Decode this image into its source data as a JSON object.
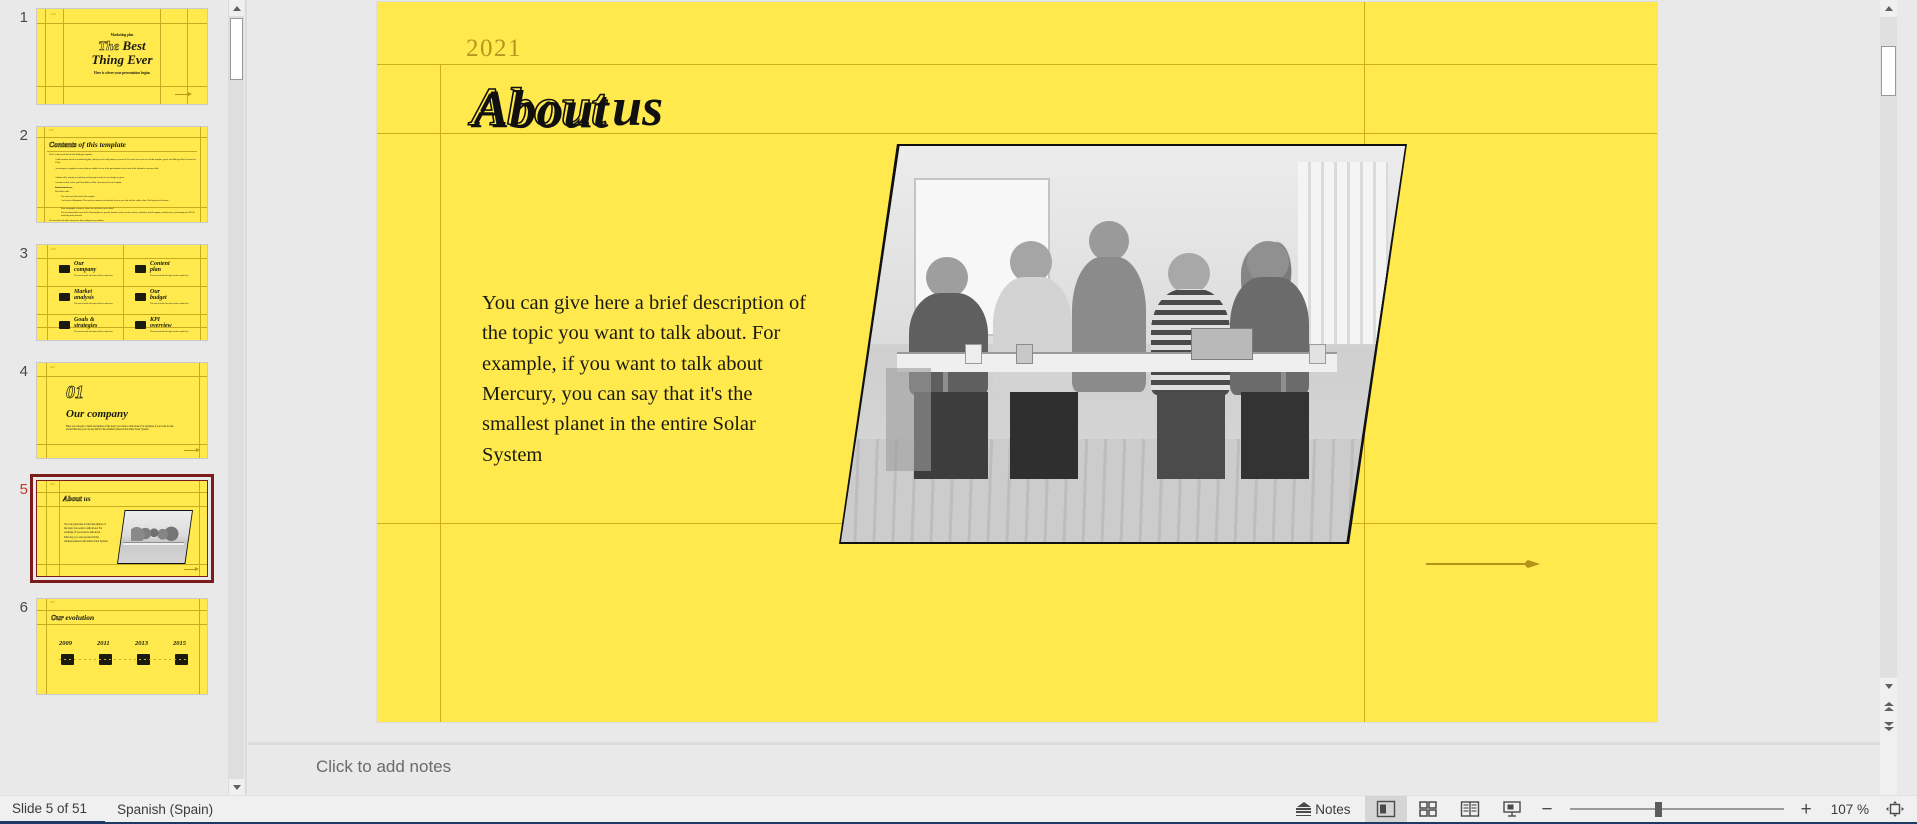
{
  "app": {
    "accent_color": "#1f3864",
    "slide_bg": "#ffe94d",
    "slide_rule_color": "#cfae1d",
    "ink_color": "#101010",
    "muted_gold": "#b3971f",
    "selection_border": "#7b1b1b"
  },
  "thumbnails": {
    "panel_name": "slide-thumbnail-panel",
    "slides": [
      {
        "number": "1",
        "selected": false,
        "kind": "title",
        "eyebrow": "Marketing plan",
        "title_hollow": "The",
        "title_solid": "Best",
        "title_line2": "Thing Ever",
        "subtitle": "Here is where your presentation begins"
      },
      {
        "number": "2",
        "selected": false,
        "kind": "contents",
        "title_hollow": "Contents",
        "title_solid": "of this template",
        "intro": "Here's what you'll find in this Slidesgo template:",
        "items": [
          "A slide structure based on a marketing plan, which you can easily adapt to your needs. For more info on how to edit the template, please visit Slidesgo School or read our FAQs.",
          "An assortment of graphic resources that are suitable for use in the presentation can be found in the alternative resources slide.",
          "A thanks slide, which you must keep so that proper credits for our design are given.",
          "A resources slide, where you'll find links to all the elements used in the template.",
          "Instructions for use.",
          "Final slides with:"
        ],
        "subitems": [
          "The fonts and colors used in the template.",
          "A selection of illustrations. You can also customize and animate them as you wish with the online editor. Visit Storyset to find more.",
          "More infographic resources, whose size and color can be edited.",
          "Sets of customizable icons of the following themes: general, business, avatar, creative process, education, help & support, medical, nature, performing arts, SEO & marketing and teamwork."
        ],
        "footer": "You can delete this slide when you're done editing the presentation."
      },
      {
        "number": "3",
        "selected": false,
        "kind": "toc-grid",
        "entries": [
          {
            "num": "01",
            "label": "Our\ncompany",
            "desc": "You can describe the topic of the section here"
          },
          {
            "num": "04",
            "label": "Content\nplan",
            "desc": "You can describe the topic of the section here"
          },
          {
            "num": "02",
            "label": "Market\nanalysis",
            "desc": "You can describe the topic of the section here"
          },
          {
            "num": "05",
            "label": "Our\nbudget",
            "desc": "You can describe the topic of the section here"
          },
          {
            "num": "03",
            "label": "Goals &\nstrategies",
            "desc": "You can describe the topic of the section here"
          },
          {
            "num": "06",
            "label": "KPI\noverview",
            "desc": "You can describe the topic of the section here"
          }
        ]
      },
      {
        "number": "4",
        "selected": false,
        "kind": "section",
        "big_number": "01",
        "title": "Our company",
        "body": "Here you can give a brief description of the topic you want to talk about. For example, if you want to talk about Mercury, you can say that it's the smallest planet in the entire Solar System"
      },
      {
        "number": "5",
        "selected": true,
        "kind": "about",
        "title_hollow": "About",
        "title_solid": "us",
        "body": "You can give here a brief description of the topic you want to talk about. For example, if you want to talk about Mercury, you can say that it's the smallest planet in the entire Solar System"
      },
      {
        "number": "6",
        "selected": false,
        "kind": "timeline",
        "title_hollow": "Our",
        "title_solid": "evolution",
        "years": [
          "2009",
          "2011",
          "2013",
          "2015"
        ]
      }
    ]
  },
  "slide": {
    "name": "about-us",
    "year": "2021",
    "title_hollow": "About",
    "title_solid": "us",
    "body": "You can give here a brief description of the topic you want to talk about. For example, if you want to talk about Mercury, you can say that it's the smallest planet in the entire Solar System",
    "image_alt": "team meeting photo",
    "arrow_icon": "arrow-right-icon"
  },
  "notes": {
    "placeholder": "Click to add notes"
  },
  "status_bar": {
    "slide_count": "Slide 5 of 51",
    "language": "Spanish (Spain)",
    "notes_label": "Notes",
    "views": [
      {
        "name": "normal-view",
        "icon": "normal-view-icon",
        "active": true
      },
      {
        "name": "slide-sorter-view",
        "icon": "slide-sorter-icon",
        "active": false
      },
      {
        "name": "reading-view",
        "icon": "reading-view-icon",
        "active": false
      },
      {
        "name": "slide-show-view",
        "icon": "slide-show-icon",
        "active": false
      }
    ],
    "zoom_out_label": "−",
    "zoom_in_label": "+",
    "zoom_value": "107 %",
    "fit_label": "fit-slide-to-window-icon"
  },
  "scrollbars": {
    "thumbnail_scrollbar": "thumbnail-scrollbar",
    "main_scrollbar": "slide-scrollbar",
    "previous_slide": "previous-slide-button",
    "next_slide": "next-slide-button"
  }
}
